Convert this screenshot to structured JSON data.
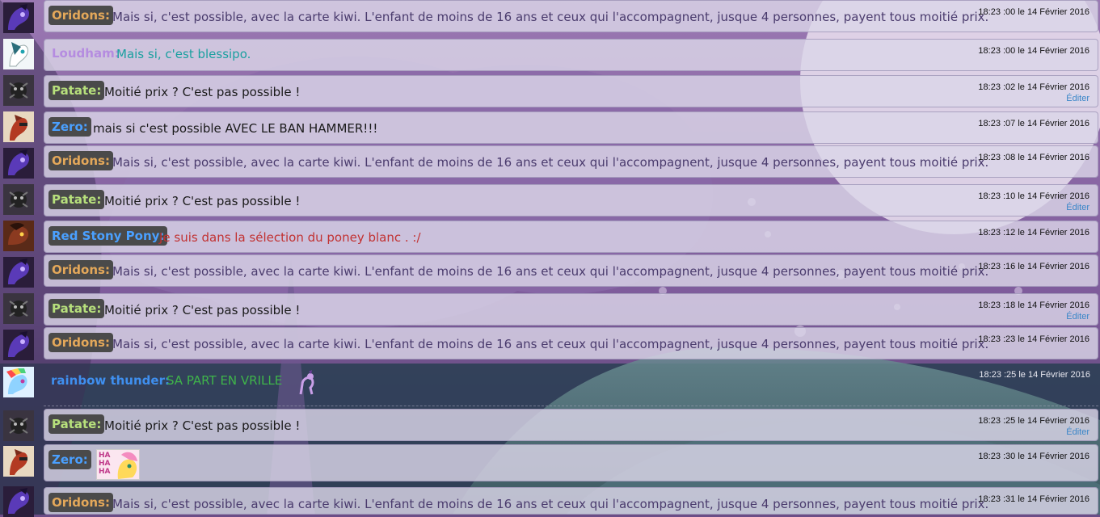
{
  "colors": {
    "oridons_nick": "#e4a85a",
    "patate_nick": "#b7e07c",
    "zero_nick": "#4aa0ff",
    "red_stony_nick": "#4aa0ff",
    "rainbow_nick": "#3f8fef",
    "oridons_text": "#4a3b6d",
    "purple_text": "#5a3d86",
    "dark_text": "#1a1a1a",
    "red_text": "#c23232",
    "green_text": "#3fb44a",
    "teal_text": "#1aa0a0",
    "light_purple_nick": "#b58ce0",
    "edit_link": "#3a86c8"
  },
  "messages": [
    {
      "nick": "Oridons:",
      "text": "Mais si, c'est possible, avec la carte kiwi. L'enfant de moins de 16 ans et ceux qui l'accompagnent, jusque 4 personnes, payent tous moitié prix.",
      "time": "18:23 :00 le 14 Février 2016",
      "avatar": "purple-pony-avatar"
    },
    {
      "nick": "Loudham:",
      "text": "Mais si, c'est blessipo.",
      "time": "18:23 :00 le 14 Février 2016",
      "avatar": "white-pony-avatar"
    },
    {
      "nick": "Patate:",
      "text": "Moitié prix ? C'est pas possible !",
      "time": "18:23 :02 le 14 Février 2016",
      "edit": "Éditer",
      "avatar": "shadow-pony-avatar"
    },
    {
      "nick": "Zero:",
      "text": "mais si c'est possible AVEC LE BAN HAMMER!!!",
      "time": "18:23 :07 le 14 Février 2016",
      "avatar": "red-pony-avatar"
    },
    {
      "nick": "Oridons:",
      "text": "Mais si, c'est possible, avec la carte kiwi. L'enfant de moins de 16 ans et ceux qui l'accompagnent, jusque 4 personnes, payent tous moitié prix.",
      "time": "18:23 :08 le 14 Février 2016",
      "avatar": "purple-pony-avatar"
    },
    {
      "nick": "Patate:",
      "text": "Moitié prix ? C'est pas possible !",
      "time": "18:23 :10 le 14 Février 2016",
      "edit": "Éditer",
      "avatar": "shadow-pony-avatar"
    },
    {
      "nick": "Red Stony Pony:",
      "text": "Je suis dans la sélection du poney blanc . :/",
      "time": "18:23 :12 le 14 Février 2016",
      "avatar": "brown-pony-avatar"
    },
    {
      "nick": "Oridons:",
      "text": "Mais si, c'est possible, avec la carte kiwi. L'enfant de moins de 16 ans et ceux qui l'accompagnent, jusque 4 personnes, payent tous moitié prix.",
      "time": "18:23 :16 le 14 Février 2016",
      "avatar": "purple-pony-avatar"
    },
    {
      "nick": "Patate:",
      "text": "Moitié prix ? C'est pas possible !",
      "time": "18:23 :18 le 14 Février 2016",
      "edit": "Éditer",
      "avatar": "shadow-pony-avatar"
    },
    {
      "nick": "Oridons:",
      "text": "Mais si, c'est possible, avec la carte kiwi. L'enfant de moins de 16 ans et ceux qui l'accompagnent, jusque 4 personnes, payent tous moitié prix.",
      "time": "18:23 :23 le 14 Février 2016",
      "avatar": "purple-pony-avatar"
    },
    {
      "nick": "rainbow thunder:",
      "text": "SA PART EN VRILLE",
      "time": "18:23 :25 le 14 Février 2016",
      "avatar": "rainbow-pony-avatar"
    },
    {
      "nick": "Patate:",
      "text": "Moitié prix ? C'est pas possible !",
      "time": "18:23 :25 le 14 Février 2016",
      "edit": "Éditer",
      "avatar": "shadow-pony-avatar"
    },
    {
      "nick": "Zero:",
      "image_text": "HA HA HA",
      "time": "18:23 :30 le 14 Février 2016",
      "avatar": "red-pony-avatar"
    },
    {
      "nick": "Oridons:",
      "text": "Mais si, c'est possible, avec la carte kiwi. L'enfant de moins de 16 ans et ceux qui l'accompagnent, jusque 4 personnes, payent tous moitié prix.",
      "time": "18:23 :31 le 14 Février 2016",
      "avatar": "purple-pony-avatar"
    }
  ]
}
